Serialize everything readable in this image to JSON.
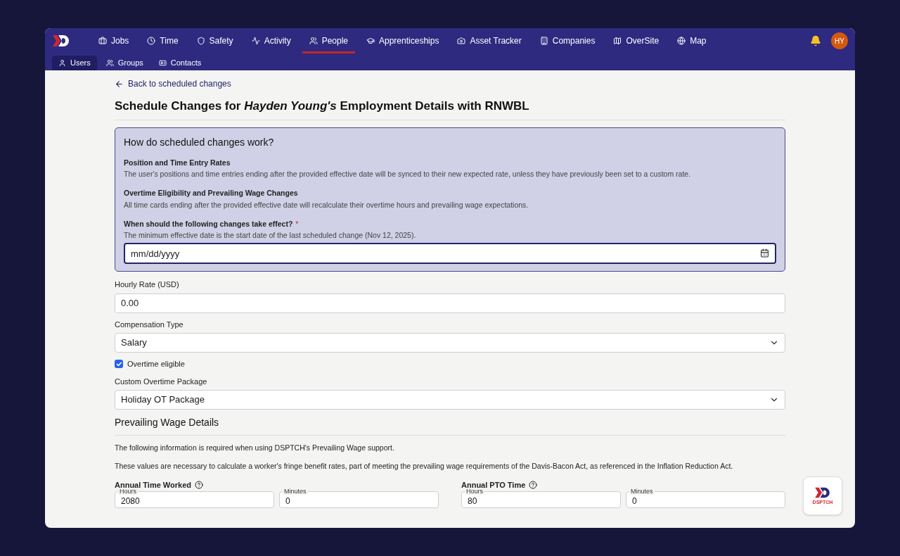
{
  "nav": {
    "items": [
      {
        "label": "Jobs",
        "selected": false
      },
      {
        "label": "Time",
        "selected": false
      },
      {
        "label": "Safety",
        "selected": false
      },
      {
        "label": "Activity",
        "selected": false
      },
      {
        "label": "People",
        "selected": true
      },
      {
        "label": "Apprenticeships",
        "selected": false
      },
      {
        "label": "Asset Tracker",
        "selected": false
      },
      {
        "label": "Companies",
        "selected": false
      },
      {
        "label": "OverSite",
        "selected": false
      },
      {
        "label": "Map",
        "selected": false
      }
    ],
    "avatar": "HY",
    "subitems": [
      {
        "label": "Users",
        "selected": true
      },
      {
        "label": "Groups",
        "selected": false
      },
      {
        "label": "Contacts",
        "selected": false
      }
    ]
  },
  "back_link": "Back to scheduled changes",
  "title": "Schedule Changes for *Hayden Young's* Employment Details with RNWBL",
  "info": {
    "heading": "How do scheduled changes work?",
    "sections": [
      {
        "title": "Position and Time Entry Rates",
        "text": "The user's positions and time entries ending after the provided effective date will be synced to their new expected rate, unless they have previously been set to a custom rate."
      },
      {
        "title": "Overtime Eligibility and Prevailing Wage Changes",
        "text": "All time cards ending after the provided effective date will recalculate their overtime hours and prevailing wage expectations."
      }
    ],
    "date_label": "When should the following changes take effect?",
    "required_mark": "*",
    "date_hint": "The minimum effective date is the start date of the last scheduled change (Nov 12, 2025).",
    "date_placeholder": "mm/dd/yyyy"
  },
  "form": [
    {
      "kind": "input",
      "label": "Hourly Rate (USD)",
      "value": "0.00"
    },
    {
      "kind": "select",
      "label": "Compensation Type",
      "value": "Salary"
    },
    {
      "kind": "checkbox",
      "label": "Overtime eligible",
      "checked": true
    },
    {
      "kind": "select",
      "label": "Custom Overtime Package",
      "value": "Holiday OT Package"
    }
  ],
  "prevailing": {
    "heading": "Prevailing Wage Details",
    "paragraphs": [
      "The following information is required when using DSPTCH's Prevailing Wage support.",
      "These values are necessary to calculate a worker's fringe benefit rates, part of meeting the prevailing wage requirements of the Davis-Bacon Act, as referenced in the Inflation Reduction Act."
    ],
    "groups": [
      {
        "label": "Annual Time Worked",
        "fields": [
          {
            "label": "Hours",
            "value": "2080"
          },
          {
            "label": "Minutes",
            "value": "0"
          }
        ]
      },
      {
        "label": "Annual PTO Time",
        "fields": [
          {
            "label": "Hours",
            "value": "80"
          },
          {
            "label": "Minutes",
            "value": "0"
          }
        ]
      }
    ]
  },
  "fab": {
    "logo_text": "DSPTCH"
  }
}
